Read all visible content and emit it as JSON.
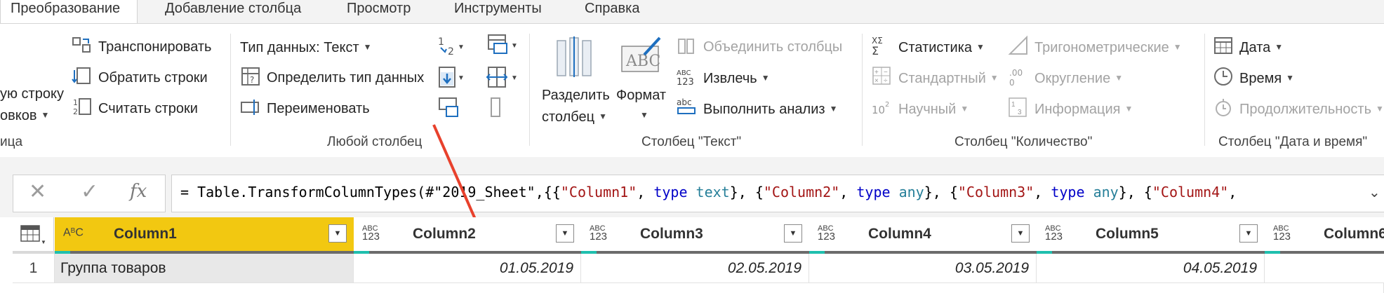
{
  "tabs": [
    {
      "label": "Преобразование",
      "active": true
    },
    {
      "label": "Добавление столбца",
      "active": false
    },
    {
      "label": "Просмотр",
      "active": false
    },
    {
      "label": "Инструменты",
      "active": false
    },
    {
      "label": "Справка",
      "active": false
    }
  ],
  "ribbon": {
    "table_group": {
      "use_first_row_partial_1": "ую строку",
      "use_first_row_partial_2": "овков",
      "transpose": "Транспонировать",
      "reverse_rows": "Обратить строки",
      "count_rows": "Считать строки",
      "group_label_partial": "ица"
    },
    "any_column": {
      "data_type": "Тип данных: Текст",
      "detect_type": "Определить тип данных",
      "rename": "Переименовать",
      "group_label": "Любой столбец"
    },
    "text_column": {
      "split_line1": "Разделить",
      "split_line2": "столбец",
      "format": "Формат",
      "merge_columns": "Объединить столбцы",
      "extract": "Извлечь",
      "parse": "Выполнить анализ",
      "group_label": "Столбец \"Текст\""
    },
    "number_column": {
      "statistics": "Статистика",
      "standard": "Стандартный",
      "scientific": "Научный",
      "trigonometry": "Тригонометрические",
      "rounding": "Округление",
      "information": "Информация",
      "group_label": "Столбец \"Количество\""
    },
    "datetime_column": {
      "date": "Дата",
      "time": "Время",
      "duration": "Продолжительность",
      "group_label": "Столбец \"Дата и время\""
    }
  },
  "formula_bar": {
    "fx": "fx",
    "prefix": "= Table.TransformColumnTypes(#\"2019_Sheet\",{{",
    "parts": [
      {
        "t": "str",
        "v": "\"Column1\""
      },
      {
        "t": "plain",
        "v": ", "
      },
      {
        "t": "kw",
        "v": "type"
      },
      {
        "t": "plain",
        "v": " "
      },
      {
        "t": "ty",
        "v": "text"
      },
      {
        "t": "plain",
        "v": "}, {"
      },
      {
        "t": "str",
        "v": "\"Column2\""
      },
      {
        "t": "plain",
        "v": ", "
      },
      {
        "t": "kw",
        "v": "type"
      },
      {
        "t": "plain",
        "v": " "
      },
      {
        "t": "ty",
        "v": "any"
      },
      {
        "t": "plain",
        "v": "}, {"
      },
      {
        "t": "str",
        "v": "\"Column3\""
      },
      {
        "t": "plain",
        "v": ", "
      },
      {
        "t": "kw",
        "v": "type"
      },
      {
        "t": "plain",
        "v": " "
      },
      {
        "t": "ty",
        "v": "any"
      },
      {
        "t": "plain",
        "v": "}, {"
      },
      {
        "t": "str",
        "v": "\"Column4\""
      },
      {
        "t": "plain",
        "v": ","
      }
    ]
  },
  "grid": {
    "columns": [
      {
        "name": "Column1",
        "type": "ABC"
      },
      {
        "name": "Column2",
        "type": "ABC123"
      },
      {
        "name": "Column3",
        "type": "ABC123"
      },
      {
        "name": "Column4",
        "type": "ABC123"
      },
      {
        "name": "Column5",
        "type": "ABC123"
      },
      {
        "name": "Column6",
        "type": "ABC123"
      }
    ],
    "rows": [
      {
        "index": "1",
        "cells": [
          "Группа товаров",
          "01.05.2019",
          "02.05.2019",
          "03.05.2019",
          "04.05.2019",
          ""
        ]
      }
    ]
  },
  "colors": {
    "selected_header": "#f2c811",
    "quality_valid": "#1fbfae",
    "quality_empty": "#6b6b6b",
    "annotation_arrow": "#e8412c"
  }
}
